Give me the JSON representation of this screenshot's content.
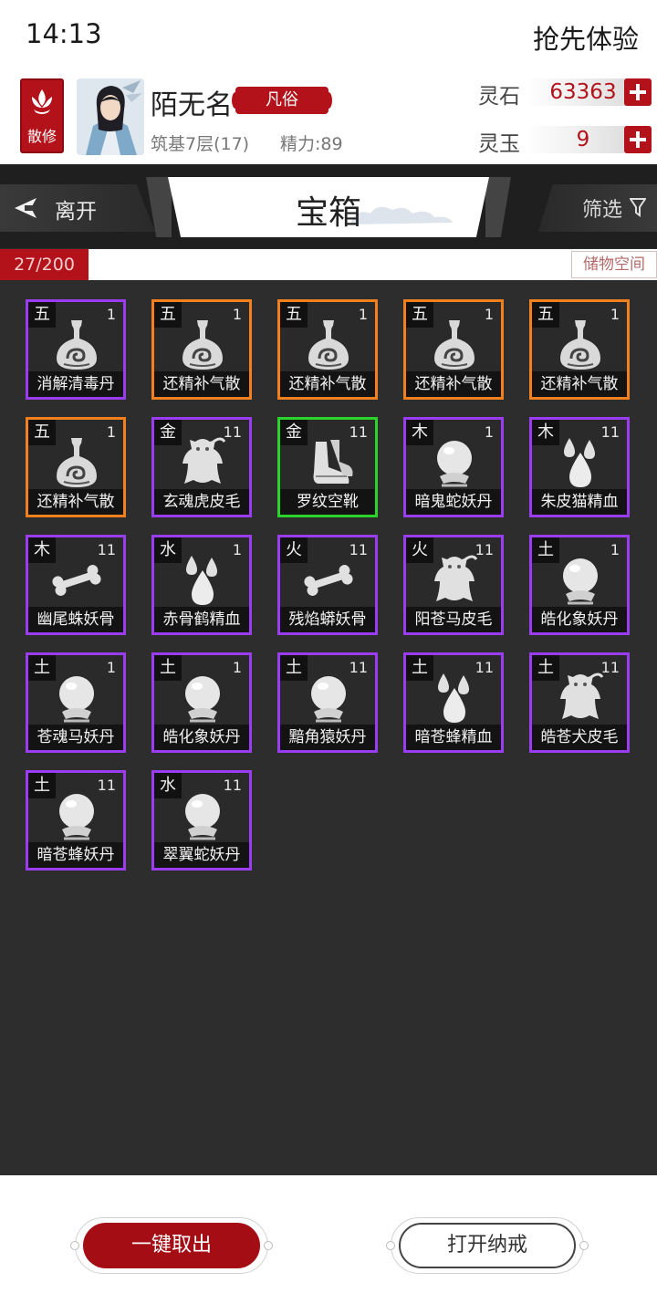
{
  "status": {
    "time": "14:13",
    "right_label": "抢先体验"
  },
  "player": {
    "sect": "散修",
    "name": "陌无名",
    "rank": "凡俗",
    "realm": "筑基7层(17)",
    "stamina": "精力:89"
  },
  "currency": [
    {
      "label": "灵石",
      "value": "63363"
    },
    {
      "label": "灵玉",
      "value": "9"
    }
  ],
  "toolbar": {
    "leave_label": "离开",
    "title": "宝箱",
    "filter_label": "筛选"
  },
  "capacity": {
    "count": "27/200",
    "storage_label": "储物空间"
  },
  "colors": {
    "accent": "#b3121a",
    "purple": "#9a3cf0",
    "orange": "#f2801e",
    "green": "#2bd42b"
  },
  "items": [
    {
      "elem": "五",
      "qty": "1",
      "name": "消解清毒丹",
      "rarity": "purple",
      "icon": "flask-icon"
    },
    {
      "elem": "五",
      "qty": "1",
      "name": "还精补气散",
      "rarity": "orange",
      "icon": "flask-icon"
    },
    {
      "elem": "五",
      "qty": "1",
      "name": "还精补气散",
      "rarity": "orange",
      "icon": "flask-icon"
    },
    {
      "elem": "五",
      "qty": "1",
      "name": "还精补气散",
      "rarity": "orange",
      "icon": "flask-icon"
    },
    {
      "elem": "五",
      "qty": "1",
      "name": "还精补气散",
      "rarity": "orange",
      "icon": "flask-icon"
    },
    {
      "elem": "五",
      "qty": "1",
      "name": "还精补气散",
      "rarity": "orange",
      "icon": "flask-icon"
    },
    {
      "elem": "金",
      "qty": "11",
      "name": "玄魂虎皮毛",
      "rarity": "purple",
      "icon": "pelt-icon"
    },
    {
      "elem": "金",
      "qty": "11",
      "name": "罗纹空靴",
      "rarity": "green",
      "icon": "boots-icon"
    },
    {
      "elem": "木",
      "qty": "1",
      "name": "暗鬼蛇妖丹",
      "rarity": "purple",
      "icon": "orb-icon"
    },
    {
      "elem": "木",
      "qty": "11",
      "name": "朱皮猫精血",
      "rarity": "purple",
      "icon": "blood-drops-icon"
    },
    {
      "elem": "木",
      "qty": "11",
      "name": "幽尾蛛妖骨",
      "rarity": "purple",
      "icon": "bone-icon"
    },
    {
      "elem": "水",
      "qty": "1",
      "name": "赤骨鹤精血",
      "rarity": "purple",
      "icon": "blood-drops-icon"
    },
    {
      "elem": "火",
      "qty": "11",
      "name": "残焰蟒妖骨",
      "rarity": "purple",
      "icon": "bone-icon"
    },
    {
      "elem": "火",
      "qty": "11",
      "name": "阳苍马皮毛",
      "rarity": "purple",
      "icon": "pelt-icon"
    },
    {
      "elem": "土",
      "qty": "1",
      "name": "皓化象妖丹",
      "rarity": "purple",
      "icon": "orb-icon"
    },
    {
      "elem": "土",
      "qty": "1",
      "name": "苍魂马妖丹",
      "rarity": "purple",
      "icon": "orb-icon"
    },
    {
      "elem": "土",
      "qty": "1",
      "name": "皓化象妖丹",
      "rarity": "purple",
      "icon": "orb-icon"
    },
    {
      "elem": "土",
      "qty": "11",
      "name": "黯角猿妖丹",
      "rarity": "purple",
      "icon": "orb-icon"
    },
    {
      "elem": "土",
      "qty": "11",
      "name": "暗苍蜂精血",
      "rarity": "purple",
      "icon": "blood-drops-icon"
    },
    {
      "elem": "土",
      "qty": "11",
      "name": "皓苍犬皮毛",
      "rarity": "purple",
      "icon": "pelt-icon"
    },
    {
      "elem": "土",
      "qty": "11",
      "name": "暗苍蜂妖丹",
      "rarity": "purple",
      "icon": "orb-icon"
    },
    {
      "elem": "水",
      "qty": "11",
      "name": "翠翼蛇妖丹",
      "rarity": "purple",
      "icon": "orb-icon"
    }
  ],
  "buttons": {
    "take_all": "一键取出",
    "open_ring": "打开纳戒"
  }
}
